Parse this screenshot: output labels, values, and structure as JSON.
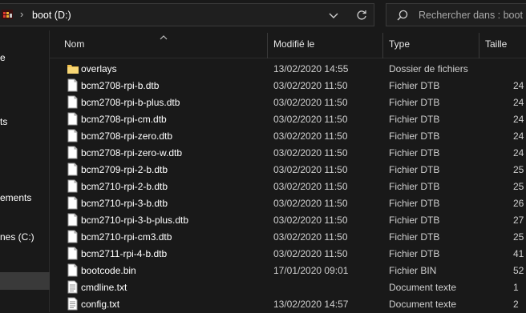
{
  "address": {
    "separator": "›",
    "path": "boot (D:)"
  },
  "search": {
    "placeholder": "Rechercher dans : boot (D:)"
  },
  "sidebar": {
    "items": [
      {
        "label": "e",
        "selected": false
      },
      {
        "label": "ts",
        "selected": false
      },
      {
        "label": "ements",
        "selected": false
      },
      {
        "label": "nes (C:)",
        "selected": false
      },
      {
        "label": "",
        "selected": true
      }
    ]
  },
  "columns": {
    "name": "Nom",
    "modified": "Modifié le",
    "type": "Type",
    "size": "Taille"
  },
  "files": [
    {
      "name": "overlays",
      "modified": "13/02/2020 14:55",
      "type": "Dossier de fichiers",
      "size": "",
      "icon": "folder-icon"
    },
    {
      "name": "bcm2708-rpi-b.dtb",
      "modified": "03/02/2020 11:50",
      "type": "Fichier DTB",
      "size": "24",
      "icon": "file-icon"
    },
    {
      "name": "bcm2708-rpi-b-plus.dtb",
      "modified": "03/02/2020 11:50",
      "type": "Fichier DTB",
      "size": "24",
      "icon": "file-icon"
    },
    {
      "name": "bcm2708-rpi-cm.dtb",
      "modified": "03/02/2020 11:50",
      "type": "Fichier DTB",
      "size": "24",
      "icon": "file-icon"
    },
    {
      "name": "bcm2708-rpi-zero.dtb",
      "modified": "03/02/2020 11:50",
      "type": "Fichier DTB",
      "size": "24",
      "icon": "file-icon"
    },
    {
      "name": "bcm2708-rpi-zero-w.dtb",
      "modified": "03/02/2020 11:50",
      "type": "Fichier DTB",
      "size": "24",
      "icon": "file-icon"
    },
    {
      "name": "bcm2709-rpi-2-b.dtb",
      "modified": "03/02/2020 11:50",
      "type": "Fichier DTB",
      "size": "25",
      "icon": "file-icon"
    },
    {
      "name": "bcm2710-rpi-2-b.dtb",
      "modified": "03/02/2020 11:50",
      "type": "Fichier DTB",
      "size": "25",
      "icon": "file-icon"
    },
    {
      "name": "bcm2710-rpi-3-b.dtb",
      "modified": "03/02/2020 11:50",
      "type": "Fichier DTB",
      "size": "26",
      "icon": "file-icon"
    },
    {
      "name": "bcm2710-rpi-3-b-plus.dtb",
      "modified": "03/02/2020 11:50",
      "type": "Fichier DTB",
      "size": "27",
      "icon": "file-icon"
    },
    {
      "name": "bcm2710-rpi-cm3.dtb",
      "modified": "03/02/2020 11:50",
      "type": "Fichier DTB",
      "size": "25",
      "icon": "file-icon"
    },
    {
      "name": "bcm2711-rpi-4-b.dtb",
      "modified": "03/02/2020 11:50",
      "type": "Fichier DTB",
      "size": "41",
      "icon": "file-icon"
    },
    {
      "name": "bootcode.bin",
      "modified": "17/01/2020 09:01",
      "type": "Fichier BIN",
      "size": "52",
      "icon": "file-icon"
    },
    {
      "name": "cmdline.txt",
      "modified": "",
      "type": "Document texte",
      "size": "1",
      "icon": "text-file-icon"
    },
    {
      "name": "config.txt",
      "modified": "13/02/2020 14:57",
      "type": "Document texte",
      "size": "2",
      "icon": "text-file-icon"
    }
  ]
}
